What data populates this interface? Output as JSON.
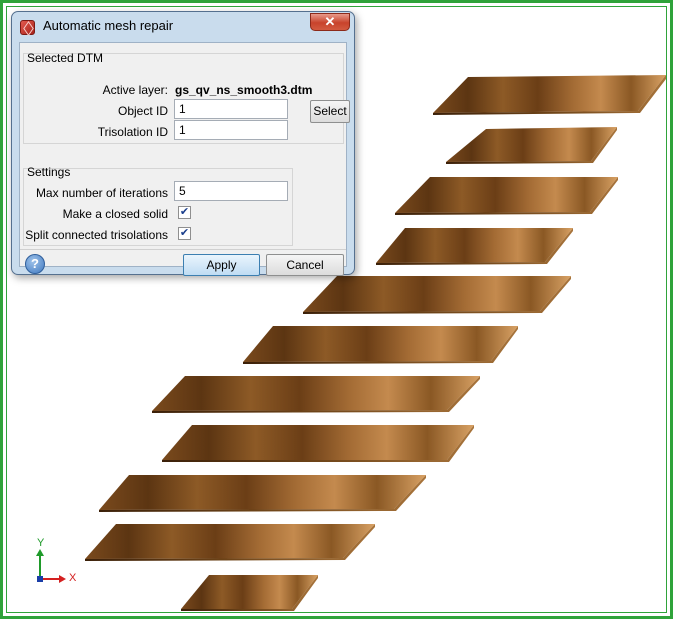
{
  "dialog": {
    "title": "Automatic mesh repair",
    "close_glyph": "✕",
    "selected_dtm": {
      "group_label": "Selected DTM",
      "active_layer_label": "Active layer:",
      "active_layer_value": "gs_qv_ns_smooth3.dtm",
      "object_id_label": "Object ID",
      "object_id_value": "1",
      "trisolation_id_label": "Trisolation ID",
      "trisolation_id_value": "1",
      "select_button": "Select"
    },
    "settings": {
      "group_label": "Settings",
      "max_iterations_label": "Max number of iterations",
      "max_iterations_value": "5",
      "closed_solid_label": "Make a closed solid",
      "closed_solid_checked": true,
      "split_label": "Split connected trisolations",
      "split_checked": true
    },
    "help_glyph": "?",
    "apply_button": "Apply",
    "cancel_button": "Cancel"
  },
  "axes": {
    "y_label": "Y",
    "x_label": "X",
    "y_color": "#1f9a2a",
    "x_color": "#d42020"
  },
  "colors": {
    "frame": "#2fa33a",
    "dialog_frame": "#c9dced",
    "accent": "#3c7fb1"
  }
}
